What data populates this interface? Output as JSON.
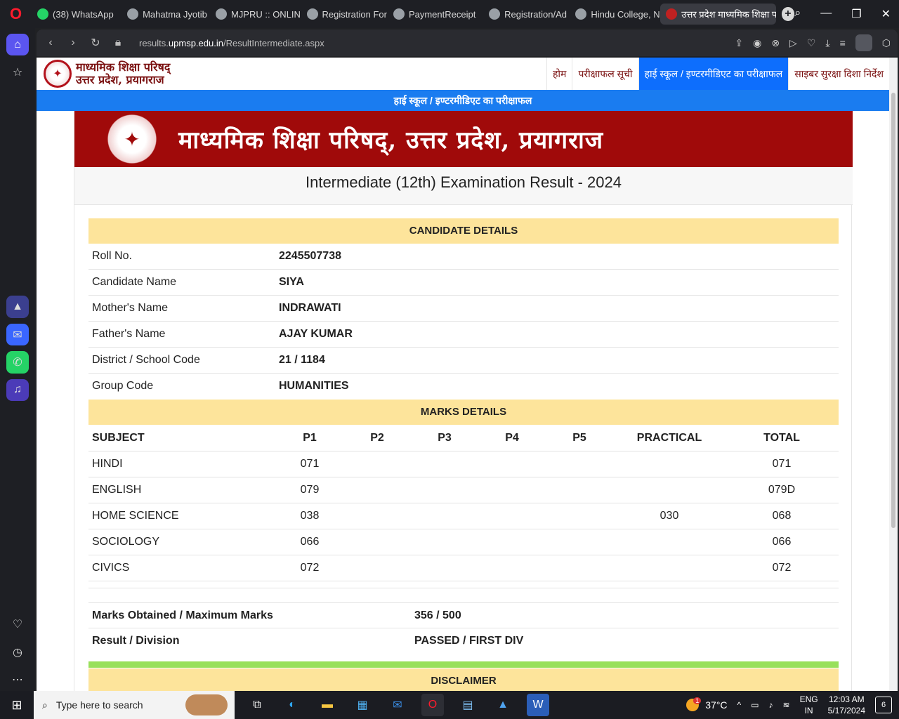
{
  "browser": {
    "tabs": [
      {
        "label": "(38) WhatsApp",
        "favicon": "whatsapp-icon"
      },
      {
        "label": "Mahatma Jyotib",
        "favicon": "site-icon"
      },
      {
        "label": "MJPRU :: ONLIN",
        "favicon": "globe-icon"
      },
      {
        "label": "Registration For",
        "favicon": "globe-icon"
      },
      {
        "label": "PaymentReceipt",
        "favicon": "globe-icon"
      },
      {
        "label": "Registration/Ad",
        "favicon": "globe-icon"
      },
      {
        "label": "Hindu College, N",
        "favicon": "globe-icon"
      },
      {
        "label": "उत्तर प्रदेश माध्यमिक शिक्षा प",
        "favicon": "upmsp-icon"
      }
    ],
    "url_prefix": "results.",
    "url_domain": "upmsp.edu.in",
    "url_path": "/ResultIntermediate.aspx"
  },
  "site": {
    "logo_line1": "माध्यमिक शिक्षा परिषद्",
    "logo_line2": "उत्तर प्रदेश, प्रयागराज",
    "menu": [
      {
        "label": "होम"
      },
      {
        "label": "परीक्षाफल सूची"
      },
      {
        "label": "हाई स्कूल / इण्टरमीडिएट का परीक्षाफल"
      },
      {
        "label": "साइबर सुरक्षा दिशा निर्देश"
      }
    ],
    "subheader": "हाई स्कूल / इण्टरमीडिएट का परीक्षाफल",
    "banner_text": "माध्यमिक शिक्षा परिषद्, उत्तर प्रदेश, प्रयागराज",
    "exam_title": "Intermediate (12th) Examination Result - 2024"
  },
  "candidate": {
    "heading": "CANDIDATE DETAILS",
    "rows": [
      {
        "label": "Roll No.",
        "value": "2245507738"
      },
      {
        "label": "Candidate Name",
        "value": "SIYA"
      },
      {
        "label": "Mother's Name",
        "value": "INDRAWATI"
      },
      {
        "label": "Father's Name",
        "value": "AJAY KUMAR"
      },
      {
        "label": "District / School Code",
        "value": "21 / 1184"
      },
      {
        "label": "Group Code",
        "value": "HUMANITIES"
      }
    ]
  },
  "marks": {
    "heading": "MARKS DETAILS",
    "columns": [
      "SUBJECT",
      "P1",
      "P2",
      "P3",
      "P4",
      "P5",
      "PRACTICAL",
      "TOTAL"
    ],
    "rows": [
      [
        "HINDI",
        "071",
        "",
        "",
        "",
        "",
        "",
        "071"
      ],
      [
        "ENGLISH",
        "079",
        "",
        "",
        "",
        "",
        "",
        "079D"
      ],
      [
        "HOME SCIENCE",
        "038",
        "",
        "",
        "",
        "",
        "030",
        "068"
      ],
      [
        "SOCIOLOGY",
        "066",
        "",
        "",
        "",
        "",
        "",
        "066"
      ],
      [
        "CIVICS",
        "072",
        "",
        "",
        "",
        "",
        "",
        "072"
      ]
    ]
  },
  "summary": {
    "rows": [
      {
        "label": "Marks Obtained / Maximum Marks",
        "value": "356 / 500"
      },
      {
        "label": "Result / Division",
        "value": "PASSED / FIRST DIV"
      }
    ]
  },
  "disclaimer_heading": "DISCLAIMER",
  "taskbar": {
    "search_placeholder": "Type here to search",
    "temperature": "37°C",
    "weather_badge": "1",
    "lang_line1": "ENG",
    "lang_line2": "IN",
    "time": "12:03 AM",
    "date": "5/17/2024",
    "notifications": "6"
  },
  "colors": {
    "banner": "#a00a0a",
    "menu_active": "#0d6efd",
    "section_head": "#fde49b",
    "result_bar": "#98e05a"
  }
}
